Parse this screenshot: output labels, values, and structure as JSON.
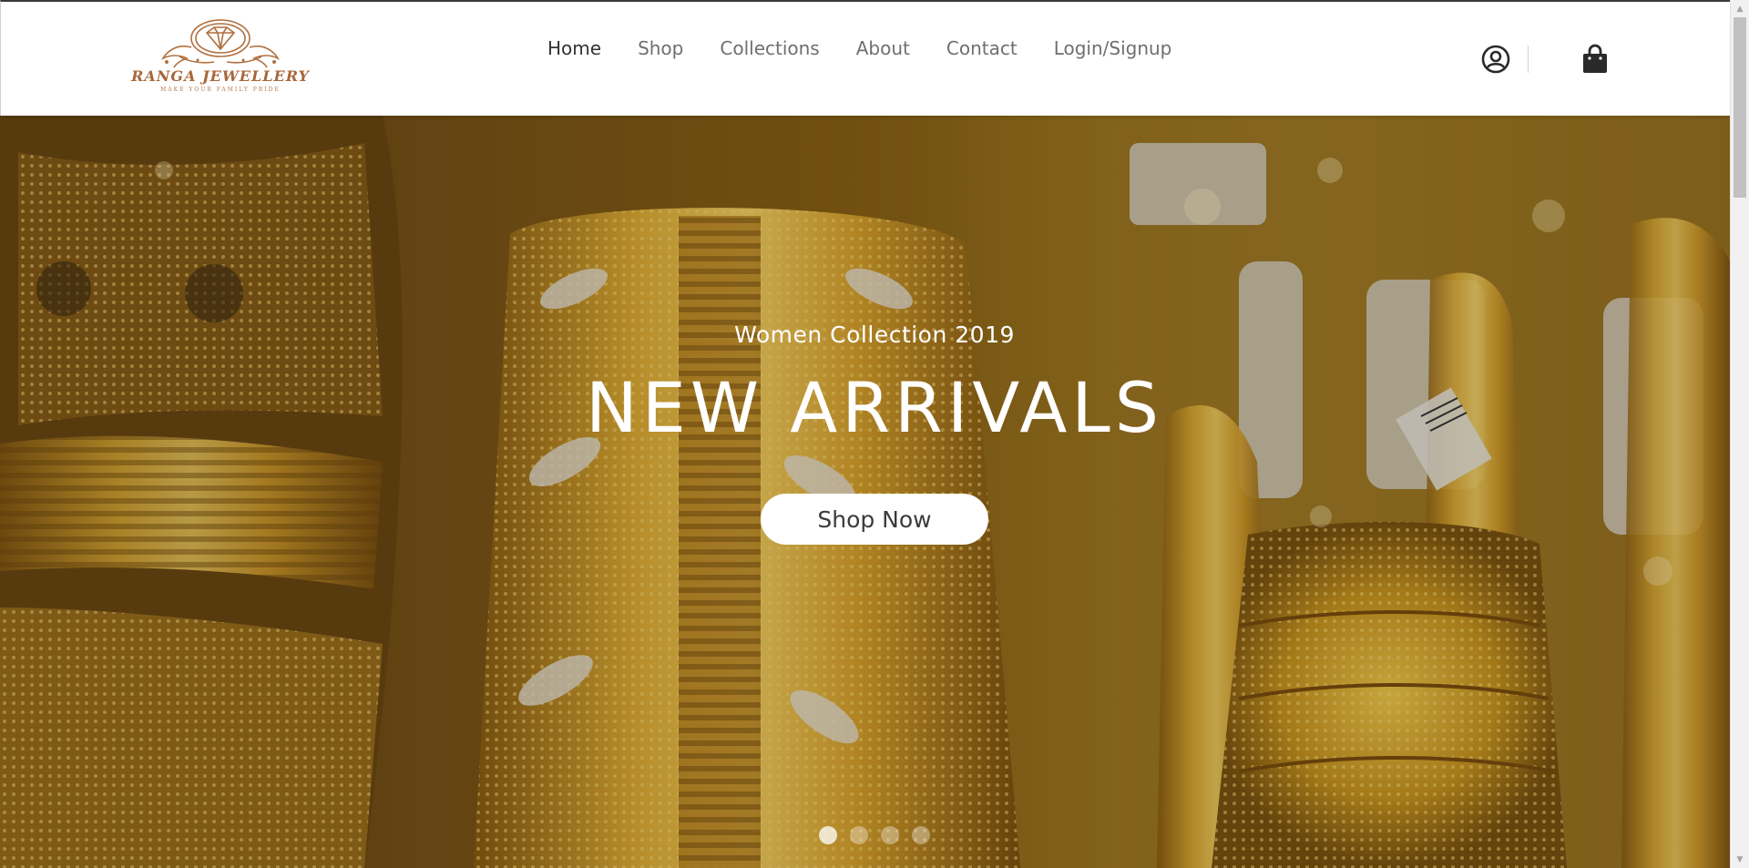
{
  "brand": {
    "name": "RANGA JEWELLERY",
    "tagline": "MAKE YOUR FAMILY PRIDE",
    "color": "#a8673a"
  },
  "nav": {
    "items": [
      {
        "label": "Home",
        "active": true
      },
      {
        "label": "Shop",
        "active": false
      },
      {
        "label": "Collections",
        "active": false
      },
      {
        "label": "About",
        "active": false
      },
      {
        "label": "Contact",
        "active": false
      },
      {
        "label": "Login/Signup",
        "active": false
      }
    ]
  },
  "header_icons": {
    "account": "user-circle-icon",
    "cart": "shopping-bag-icon"
  },
  "hero": {
    "subtitle": "Women Collection 2019",
    "title": "NEW ARRIVALS",
    "cta_label": "Shop Now",
    "slides_count": 4,
    "active_slide": 1,
    "image": "gold-bangles-photo"
  },
  "colors": {
    "header_bg": "#ffffff",
    "nav_text": "#6f6f6f",
    "nav_active": "#333333",
    "hero_gold": "#c9951f",
    "button_bg": "#ffffff"
  }
}
